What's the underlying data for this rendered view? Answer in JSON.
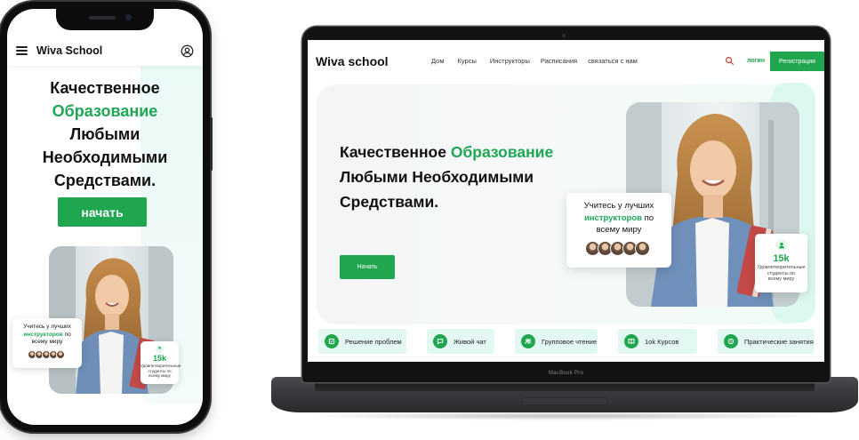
{
  "colors": {
    "accent": "#1fa64f",
    "accent_text": "#1fa755",
    "feature_bg": "#e3f7f3",
    "hero_side": "#ddf7f1"
  },
  "mobile": {
    "logo": "Wiva School",
    "menu_icon": "hamburger-icon",
    "user_icon": "user-circle-icon",
    "hero": {
      "line1": "Качественное",
      "line2_accent": "Образование",
      "line3": "Любыми",
      "line4": "Необходимыми",
      "line5": "Средствами."
    },
    "start_button": "начать",
    "card": {
      "line1": "Учитесь у лучших",
      "line2_accent": "инструкторов",
      "line2_rest": " по",
      "line3": "всему миру"
    },
    "stat": {
      "value": "15k",
      "line1": "Удовлетворительные",
      "line2": "студенты по",
      "line3": "всему миру"
    }
  },
  "laptop": {
    "logo": "Wiva school",
    "nav": [
      "Дом",
      "Курсы",
      "Инструкторы",
      "Расписания",
      "связаться с нам"
    ],
    "search_icon": "search-icon",
    "login": "логин",
    "register": "Регистрация",
    "hero": {
      "part1": "Качественное ",
      "part1_accent": "Образование",
      "line2": "Любыми Необходимыми",
      "line3": "Средствами."
    },
    "start_button": "Начать",
    "card": {
      "line1": "Учитесь у лучших",
      "line2_accent": "инструкторов",
      "line2_rest": " по",
      "line3": "всему миру"
    },
    "stat": {
      "value": "15k",
      "line1": "Удовлетворительные",
      "line2": "студенты по",
      "line3": "всему миру"
    },
    "features": [
      {
        "label": "Решение проблем",
        "icon": "problem-solving-icon"
      },
      {
        "label": "Живой чат",
        "icon": "chat-icon"
      },
      {
        "label": "Групповое чтение",
        "icon": "group-icon"
      },
      {
        "label": "1оk Курсов",
        "icon": "book-icon"
      },
      {
        "label": "Практические занятия",
        "icon": "practice-icon"
      }
    ],
    "brand_label": "MacBook Pro"
  }
}
